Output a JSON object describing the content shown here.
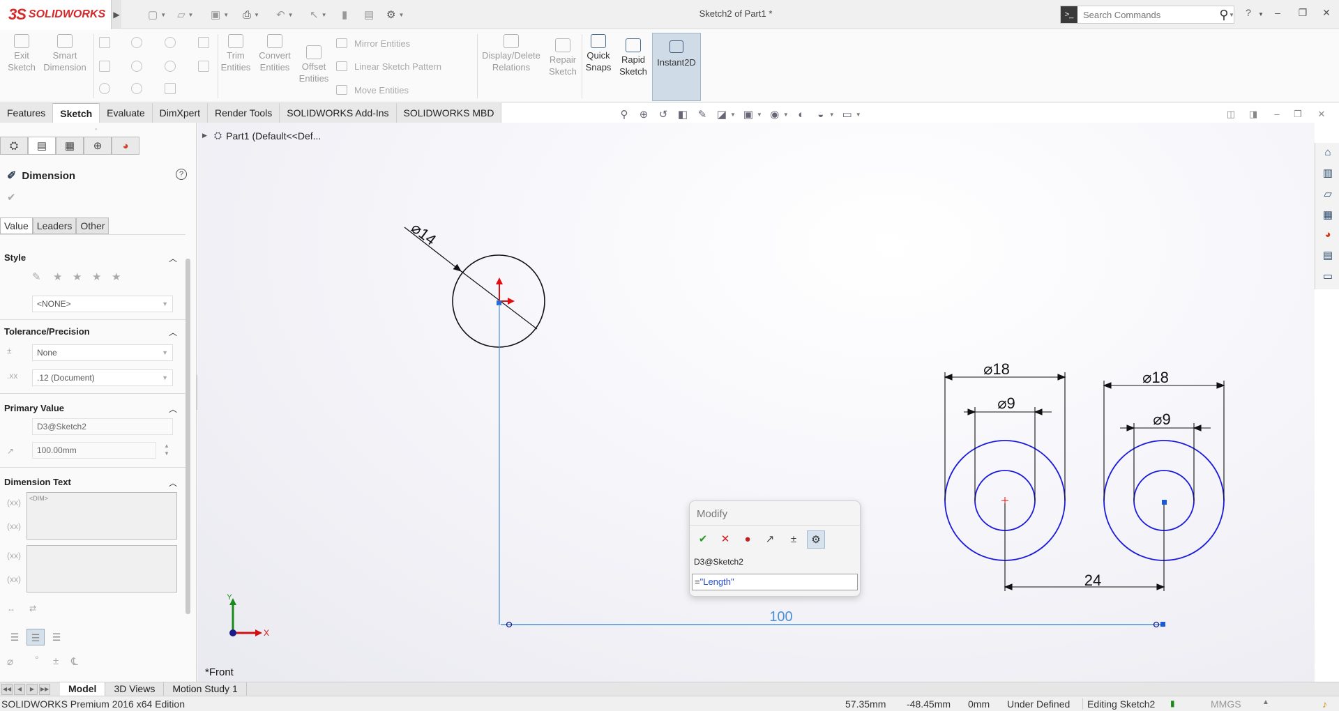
{
  "app": {
    "logo_ds": "3S",
    "logo_name": "SOLIDWORKS",
    "doc_title": "Sketch2 of Part1 *"
  },
  "search": {
    "placeholder": "Search Commands"
  },
  "toolbar": {
    "exit_sketch": "Exit Sketch",
    "smart_dimension": "Smart Dimension",
    "trim_entities": "Trim Entities",
    "convert_entities": "Convert Entities",
    "offset_entities": "Offset Entities",
    "mirror_entities": "Mirror Entities",
    "linear_sketch_pattern": "Linear Sketch Pattern",
    "move_entities": "Move Entities",
    "display_delete_relations": "Display/Delete Relations",
    "repair_sketch": "Repair Sketch",
    "quick_snaps": "Quick Snaps",
    "rapid_sketch": "Rapid Sketch",
    "instant2d": "Instant2D"
  },
  "tabs": [
    "Features",
    "Sketch",
    "Evaluate",
    "DimXpert",
    "Render Tools",
    "SOLIDWORKS Add-Ins",
    "SOLIDWORKS MBD"
  ],
  "tree": {
    "root": "Part1  (Default<<Def..."
  },
  "property_manager": {
    "title": "Dimension",
    "subtabs": [
      "Value",
      "Leaders",
      "Other"
    ],
    "style": {
      "label": "Style",
      "value": "<NONE>"
    },
    "tolerance": {
      "label": "Tolerance/Precision",
      "tolerance_value": "None",
      "precision_value": ".12 (Document)"
    },
    "primary": {
      "label": "Primary Value",
      "name": "D3@Sketch2",
      "value": "100.00mm"
    },
    "dimension_text": {
      "label": "Dimension Text",
      "text": "<DIM>"
    }
  },
  "sketch": {
    "dim_small_circle": "14",
    "dim_outer_left": "18",
    "dim_inner_left": "9",
    "dim_outer_right": "18",
    "dim_inner_right": "9",
    "dim_spacing": "24",
    "dim_length": "100",
    "view_name": "*Front",
    "axis_x": "X",
    "axis_y": "Y"
  },
  "modify_dialog": {
    "title": "Modify",
    "dim_name": "D3@Sketch2",
    "value_prefix": "=",
    "value_expr": "\"Length\""
  },
  "bottom_tabs": [
    "Model",
    "3D Views",
    "Motion Study 1"
  ],
  "status": {
    "edition": "SOLIDWORKS Premium 2016 x64 Edition",
    "x": "57.35mm",
    "y": "-48.45mm",
    "z": "0mm",
    "state": "Under Defined",
    "editing": "Editing Sketch2",
    "units": "MMGS"
  },
  "colors": {
    "brand": "#d6282a",
    "sketch_blue": "#1a1adb",
    "dim_blue": "#4a8fd8"
  }
}
